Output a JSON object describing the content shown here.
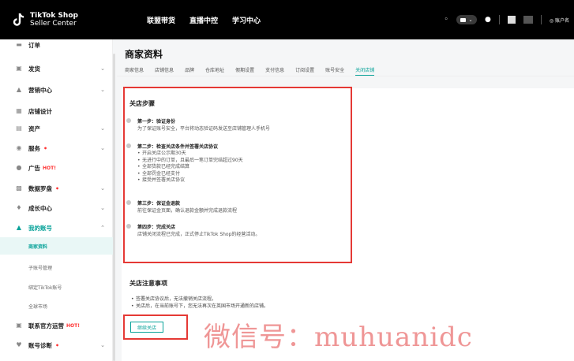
{
  "header": {
    "brand_line1": "TikTok Shop",
    "brand_line2": "Seller Center",
    "nav": [
      "联盟带货",
      "直播中控",
      "学习中心"
    ],
    "account_label": "◎ 账户名"
  },
  "sidebar": {
    "items": [
      {
        "label": "订单"
      },
      {
        "label": "发货"
      },
      {
        "label": "营销中心"
      },
      {
        "label": "店铺设计"
      },
      {
        "label": "资产"
      },
      {
        "label": "服务"
      },
      {
        "label": "广告",
        "badge": "HOT!"
      },
      {
        "label": "数据罗盘"
      },
      {
        "label": "成长中心"
      },
      {
        "label": "我的账号"
      },
      {
        "label": "联系官方运营",
        "badge": "HOT!"
      },
      {
        "label": "账号诊断"
      }
    ],
    "sub_items": [
      "商家资料",
      "子账号管理",
      "绑定TikTok账号",
      "全球市场"
    ]
  },
  "main": {
    "title": "商家资料",
    "tabs": [
      "商家信息",
      "店铺信息",
      "品牌",
      "仓库地址",
      "假期设置",
      "支付信息",
      "订阅设置",
      "账号安全",
      "关闭店铺"
    ],
    "active_tab": "关闭店铺"
  },
  "steps_card": {
    "title": "关店步骤",
    "step1_head": "第一步：验证身份",
    "step1_desc": "为了保证账号安全，平台将动态验证码发送至店铺管理人手机号",
    "step2_head": "第二步：检查关店条件并签署关店协议",
    "step2_items": [
      "开启关店公示期30天",
      "无进行中的订单，且最后一笔订单完结超过90天",
      "全部货款已经完成结算",
      "全部罚金已经支付",
      "接受并签署关店协议"
    ],
    "step3_head": "第三步：保证金退款",
    "step3_desc": "前往保证金页面，确认退款金额并完成退款流程",
    "step4_head": "第四步：完成关店",
    "step4_desc": "店铺关闭流程已完成，正式停止TikTok Shop的经营活动。"
  },
  "notes_card": {
    "title": "关店注意事项",
    "notes": [
      "签署关店协议后，无法撤销关店流程。",
      "关店后，在当前账号下，您无法再次在英国市场开通新的店铺。"
    ],
    "continue_button": "继续关店"
  },
  "watermark": "微信号：muhuanidc",
  "colors": {
    "accent": "#0aa39a",
    "highlight_box": "#e53935",
    "topbar": "#000000"
  }
}
